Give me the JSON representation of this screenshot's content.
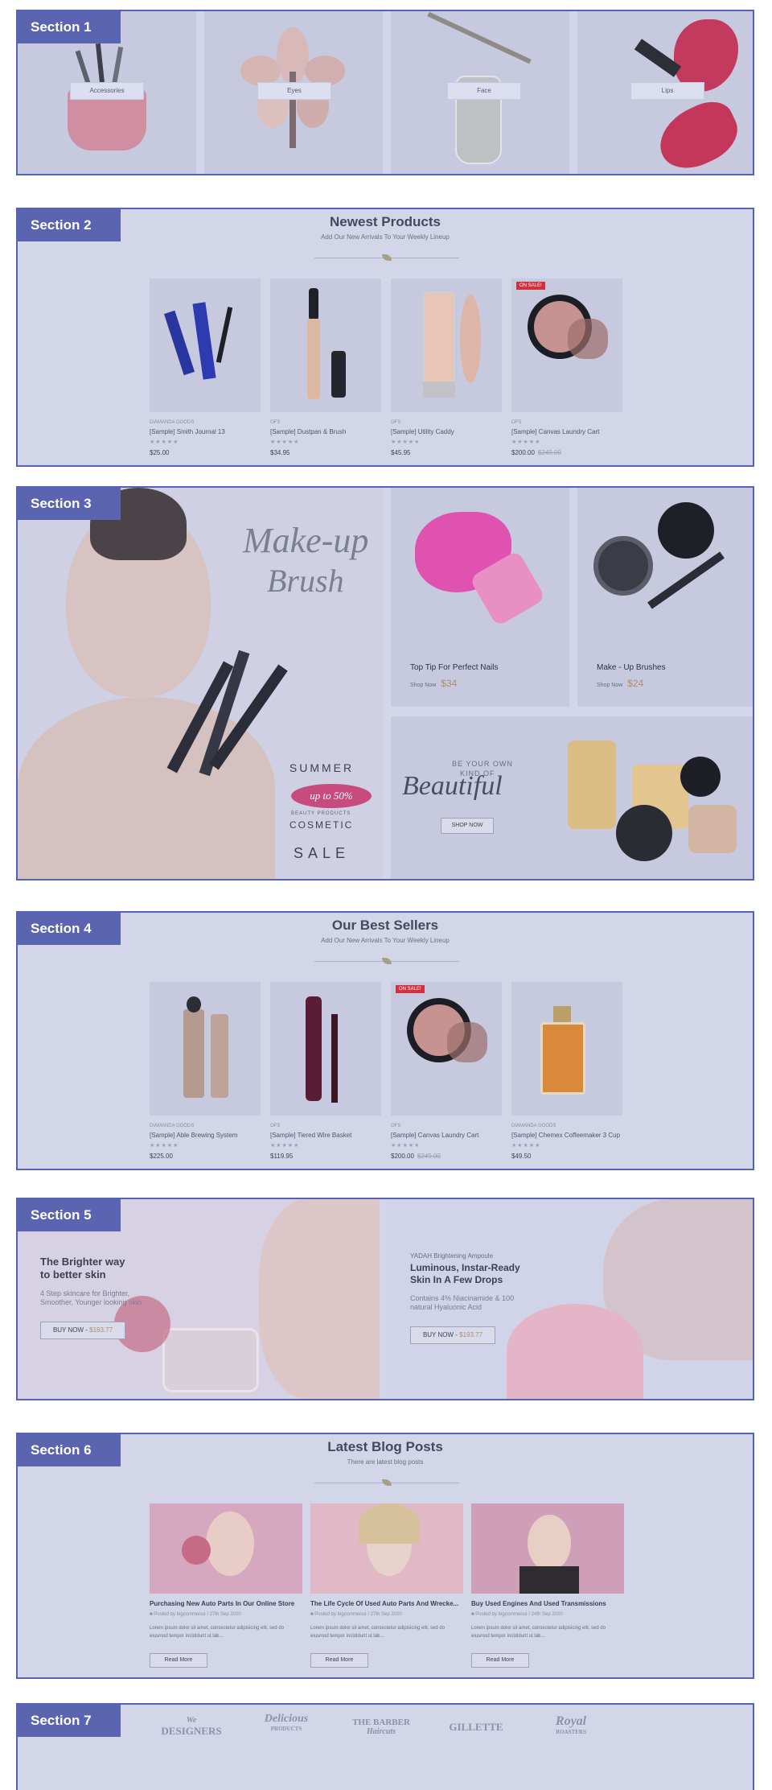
{
  "section_tags": [
    "Section 1",
    "Section 2",
    "Section 3",
    "Section 4",
    "Section 5",
    "Section 6",
    "Section 7"
  ],
  "categories": [
    {
      "label": "Accessories"
    },
    {
      "label": "Eyes"
    },
    {
      "label": "Face"
    },
    {
      "label": "Lips"
    }
  ],
  "newest": {
    "title": "Newest Products",
    "subtitle": "Add Our New Arrivals To Your Weekly Lineup",
    "products": [
      {
        "category": "DIAMANDA GOODS",
        "name": "[Sample] Smith Journal 13",
        "stars": "★★★★★",
        "price": "$25.00",
        "old": "",
        "badge": ""
      },
      {
        "category": "OFS",
        "name": "[Sample] Dustpan & Brush",
        "stars": "★★★★★",
        "price": "$34.95",
        "old": "",
        "badge": ""
      },
      {
        "category": "OFS",
        "name": "[Sample] Utility Caddy",
        "stars": "★★★★★",
        "price": "$45.95",
        "old": "",
        "badge": ""
      },
      {
        "category": "OFS",
        "name": "[Sample] Canvas Laundry Cart",
        "stars": "★★★★★",
        "price": "$200.00",
        "old": "$249.00",
        "badge": "ON SALE!"
      }
    ]
  },
  "promo": {
    "main_script": "Make-up",
    "main_script2": "Brush",
    "summer": "SUMMER",
    "upto": "up to 50%",
    "beauty_products": "BEAUTY PRODUCTS",
    "cosmetic": "COSMETIC",
    "sale": "SALE",
    "tile1_title": "Top Tip For Perfect Nails",
    "tile1_shop": "Shop Now",
    "tile1_price": "$34",
    "tile2_title": "Make - Up Brushes",
    "tile2_shop": "Shop Now",
    "tile2_price": "$24",
    "beautiful_small": "BE YOUR OWN",
    "beautiful_small2": "KIND OF",
    "beautiful_script": "Beautiful",
    "beautiful_btn": "SHOP NOW"
  },
  "best": {
    "title": "Our Best Sellers",
    "subtitle": "Add Our New Arrivals To Your Weekly Lineup",
    "products": [
      {
        "category": "DIAMANDA GOODS",
        "name": "[Sample] Able Brewing System",
        "stars": "★★★★★",
        "price": "$225.00",
        "old": "",
        "badge": ""
      },
      {
        "category": "OFS",
        "name": "[Sample] Tiered Wire Basket",
        "stars": "★★★★★",
        "price": "$119.95",
        "old": "",
        "badge": ""
      },
      {
        "category": "OFS",
        "name": "[Sample] Canvas Laundry Cart",
        "stars": "★★★★★",
        "price": "$200.00",
        "old": "$249.00",
        "badge": "ON SALE!"
      },
      {
        "category": "DIAMANDA GOODS",
        "name": "[Sample] Chemex Coffeemaker 3 Cup",
        "stars": "★★★★★",
        "price": "$49.50",
        "old": "",
        "badge": ""
      }
    ]
  },
  "banners": {
    "left_title": "The Brighter way",
    "left_title2": "to better skin",
    "left_text": "4 Step skincare for Brighter,",
    "left_text2": "Smoother, Younger looking skin",
    "left_btn": "BUY NOW - ",
    "left_price": "$193.77",
    "right_kicker": "YADAH Brightening Ampoule",
    "right_title": "Luminous, Instar-Ready",
    "right_title2": "Skin In A Few Drops",
    "right_text": "Contains 4% Niacinamide & 100",
    "right_text2": "natural Hyaluonic Acid",
    "right_btn": "BUY NOW - ",
    "right_price": "$193.77"
  },
  "blog": {
    "title": "Latest Blog Posts",
    "subtitle": "There are latest blog posts",
    "read_more": "Read More",
    "posts": [
      {
        "title": "Purchasing New Auto Parts In Our Online Store",
        "meta": "Posted by bigcommerce / 27th Sep 2020",
        "text": "Lorem ipsum dolor sit amet, consectetur adipisicing elit, sed do",
        "text2": "eiusmod tempor incididunt ut lab..."
      },
      {
        "title": "The Life Cycle Of Used Auto Parts And Wrecke...",
        "meta": "Posted by bigcommerce / 27th Sep 2020",
        "text": "Lorem ipsum dolor sit amet, consectetur adipisicing elit, sed do",
        "text2": "eiusmod tempor incididunt ut lab..."
      },
      {
        "title": "Buy Used Engines And Used Transmissions",
        "meta": "Posted by bigcommerce / 24th Sep 2020",
        "text": "Lorem ipsum dolor sit amet, consectetur adipisicing elit, sed do",
        "text2": "eiusmod tempor incididunt ut lab..."
      }
    ]
  },
  "brands": [
    {
      "line1": "We",
      "line2": "DESIGNERS"
    },
    {
      "line1": "Delicious",
      "line2": "PRODUCTS"
    },
    {
      "line1": "THE BARBER",
      "line2": "Haircuts"
    },
    {
      "line1": "GILLETTE",
      "line2": ""
    },
    {
      "line1": "Royal",
      "line2": "ROASTERS"
    }
  ],
  "colors": {
    "accent": "#5a64b0",
    "overlay": "#d3d5e9",
    "sale": "#d1303f",
    "price_accent": "#b08d6a"
  }
}
